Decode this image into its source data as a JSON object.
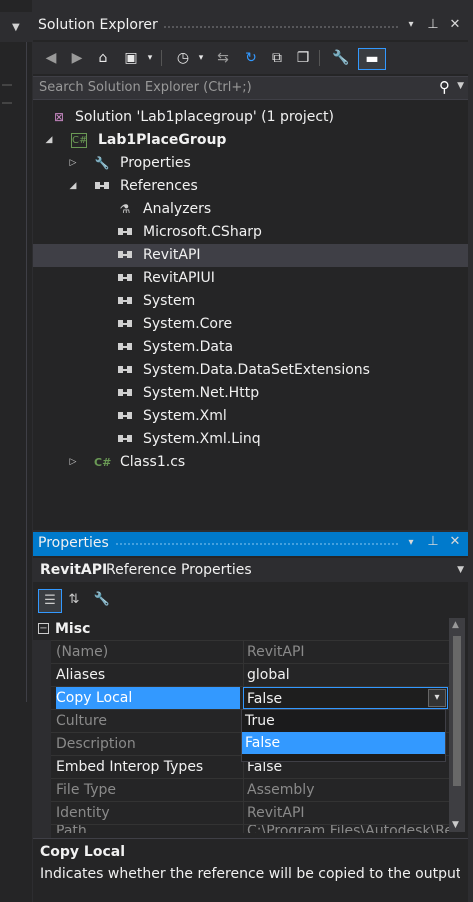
{
  "left_strip": {
    "arrow_icon": "chevron-down-icon"
  },
  "solution_explorer": {
    "title": "Solution Explorer",
    "title_buttons": [
      "▾",
      "⊥",
      "✕"
    ],
    "search_placeholder": "Search Solution Explorer (Ctrl+;)",
    "toolbar": [
      "back-icon",
      "forward-icon",
      "home-icon",
      "switch-views-icon",
      "history-icon",
      "sync-icon",
      "refresh-icon",
      "collapse-all-icon",
      "show-all-files-icon",
      "properties-icon",
      "preview-icon"
    ],
    "tree": [
      {
        "label": "Solution 'Lab1placegroup' (1 project)",
        "icon": "solution-icon",
        "expander": "",
        "bold": false
      },
      {
        "label": "Lab1PlaceGroup",
        "icon": "csharp-project-icon",
        "expander": "expanded",
        "bold": true
      },
      {
        "label": "Properties",
        "icon": "wrench-icon",
        "expander": "collapsed",
        "bold": false
      },
      {
        "label": "References",
        "icon": "reference-icon",
        "expander": "expanded",
        "bold": false
      },
      {
        "label": "Analyzers",
        "icon": "analyzer-icon",
        "expander": "",
        "bold": false
      },
      {
        "label": "Microsoft.CSharp",
        "icon": "reference-icon",
        "expander": "",
        "bold": false
      },
      {
        "label": "RevitAPI",
        "icon": "reference-icon",
        "expander": "",
        "bold": false,
        "selected": true
      },
      {
        "label": "RevitAPIUI",
        "icon": "reference-icon",
        "expander": "",
        "bold": false
      },
      {
        "label": "System",
        "icon": "reference-icon",
        "expander": "",
        "bold": false
      },
      {
        "label": "System.Core",
        "icon": "reference-icon",
        "expander": "",
        "bold": false
      },
      {
        "label": "System.Data",
        "icon": "reference-icon",
        "expander": "",
        "bold": false
      },
      {
        "label": "System.Data.DataSetExtensions",
        "icon": "reference-icon",
        "expander": "",
        "bold": false
      },
      {
        "label": "System.Net.Http",
        "icon": "reference-icon",
        "expander": "",
        "bold": false
      },
      {
        "label": "System.Xml",
        "icon": "reference-icon",
        "expander": "",
        "bold": false
      },
      {
        "label": "System.Xml.Linq",
        "icon": "reference-icon",
        "expander": "",
        "bold": false
      },
      {
        "label": "Class1.cs",
        "icon": "csharp-file-icon",
        "expander": "collapsed",
        "bold": false
      }
    ]
  },
  "properties": {
    "title": "Properties",
    "title_buttons": [
      "▾",
      "⊥",
      "✕"
    ],
    "object_name": "RevitAPI",
    "object_type": "Reference Properties",
    "category": "Misc",
    "rows": [
      {
        "key": "(Name)",
        "value": "RevitAPI",
        "readonly": true
      },
      {
        "key": "Aliases",
        "value": "global",
        "readonly": false
      },
      {
        "key": "Copy Local",
        "value": "False",
        "readonly": false,
        "selected": true
      },
      {
        "key": "Culture",
        "value": "",
        "readonly": true
      },
      {
        "key": "Description",
        "value": "",
        "readonly": true
      },
      {
        "key": "Embed Interop Types",
        "value": "False",
        "readonly": false
      },
      {
        "key": "File Type",
        "value": "Assembly",
        "readonly": true
      },
      {
        "key": "Identity",
        "value": "RevitAPI",
        "readonly": true
      },
      {
        "key": "Path",
        "value": "C:\\Program Files\\Autodesk\\Revit",
        "readonly": true
      }
    ],
    "dropdown_options": [
      "True",
      "False"
    ],
    "dropdown_highlighted": "False",
    "description_title": "Copy Local",
    "description_text": "Indicates whether the reference will be copied to the output directory."
  },
  "colors": {
    "accent": "#007acc",
    "selection": "#3399ff",
    "background": "#252526"
  }
}
